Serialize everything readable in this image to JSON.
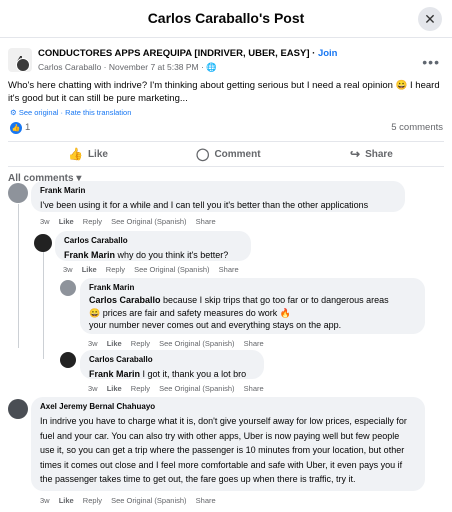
{
  "header": {
    "title": "Carlos Caraballo's Post",
    "close_icon": "close-icon"
  },
  "post": {
    "group_name": "CONDUCTORES APPS AREQUIPA [INDRIVER, UBER, EASY]",
    "join_label": "Join",
    "author": "Carlos Caraballo",
    "date": "November 7 at 5:38 PM",
    "text": "Who's here chatting with indrive? I'm thinking about getting serious but I need a real opinion 😀 I heard it's good but it can still be pure marketing...",
    "see_original": "See original",
    "rate_translation": "Rate this translation",
    "like_count": "1",
    "comment_count": "5 comments"
  },
  "actions": {
    "like": "Like",
    "comment": "Comment",
    "share": "Share"
  },
  "filter": {
    "label": "All comments"
  },
  "comments": [
    {
      "name": "Frank Marin",
      "mention": "",
      "text": "I've been using it for a while and I can tell you it's better than the other applications",
      "time": "3w"
    },
    {
      "name": "Carlos Caraballo",
      "mention": "Frank Marin",
      "text": "why do you think it's better?",
      "time": "3w"
    },
    {
      "name": "Frank Marin",
      "mention": "Carlos Caraballo",
      "text_1": "because I skip trips that go too far or to dangerous areas",
      "text_2": "😀 prices are fair and safety measures do work 🔥",
      "text_3": "your number never comes out and everything stays on the app.",
      "time": "3w"
    },
    {
      "name": "Carlos Caraballo",
      "mention": "Frank Marin",
      "text": "I got it, thank you a lot bro",
      "time": "3w"
    },
    {
      "name": "Axel Jeremy Bernal Chahuayo",
      "mention": "",
      "text": "In indrive you have to charge what it is, don't give yourself away for low prices, especially for fuel and your car. You can also try with other apps, Uber is now paying well but few people use it, so you can get a trip where the passenger is 10 minutes from your location, but other times it comes out close and I feel more comfortable and safe with Uber, it even pays you if the passenger takes time to get out, the fare goes up when there is traffic, try it.",
      "time": "3w"
    }
  ],
  "comment_actions": {
    "like": "Like",
    "reply": "Reply",
    "see_original": "See Original (Spanish)",
    "share": "Share"
  }
}
